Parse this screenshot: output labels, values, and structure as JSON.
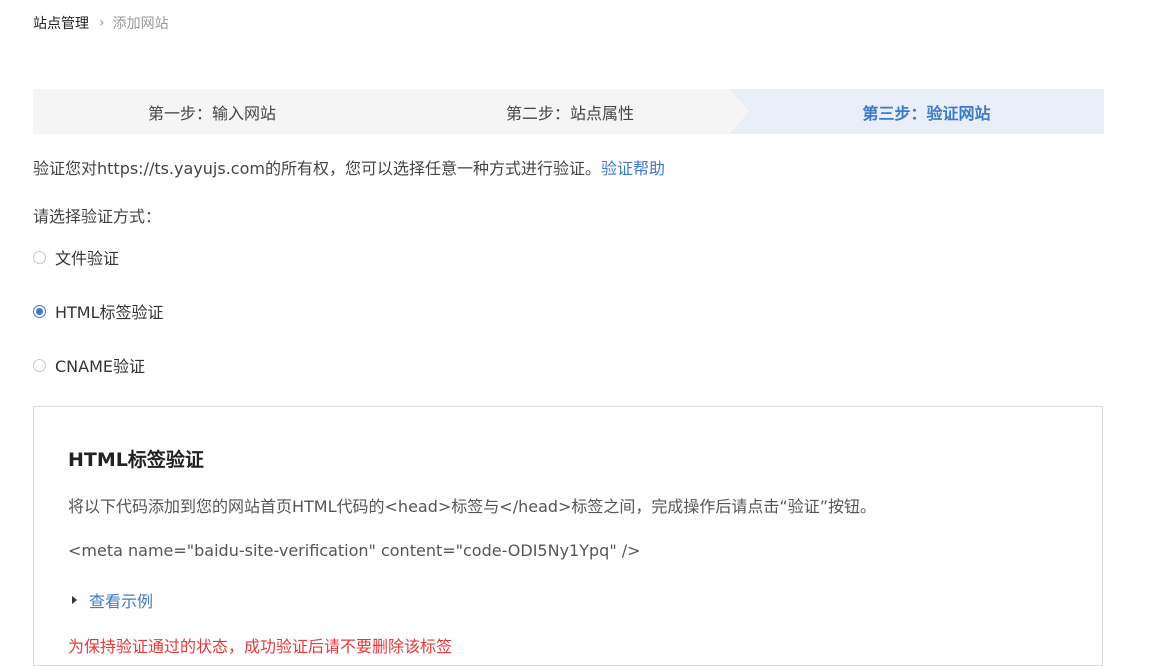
{
  "breadcrumb": {
    "home": "站点管理",
    "separator": "›",
    "current": "添加网站"
  },
  "steps": [
    {
      "label": "第一步：输入网站",
      "active": false
    },
    {
      "label": "第二步：站点属性",
      "active": false
    },
    {
      "label": "第三步：验证网站",
      "active": true
    }
  ],
  "verify": {
    "intro": "验证您对https://ts.yayujs.com的所有权，您可以选择任意一种方式进行验证。",
    "help_link": "验证帮助",
    "choose_label": "请选择验证方式："
  },
  "methods": [
    {
      "label": "文件验证",
      "checked": false
    },
    {
      "label": "HTML标签验证",
      "checked": true
    },
    {
      "label": "CNAME验证",
      "checked": false
    }
  ],
  "panel": {
    "title": "HTML标签验证",
    "description": "将以下代码添加到您的网站首页HTML代码的<head>标签与</head>标签之间，完成操作后请点击“验证”按钮。",
    "code": "<meta name=\"baidu-site-verification\" content=\"code-ODI5Ny1Ypq\" />",
    "example_link": "查看示例",
    "warning": "为保持验证通过的状态，成功验证后请不要删除该标签"
  },
  "colors": {
    "accent": "#3f79c8",
    "step_active_bg": "#e8eff9",
    "step_bg": "#f5f5f5",
    "warning": "#e4393c"
  }
}
